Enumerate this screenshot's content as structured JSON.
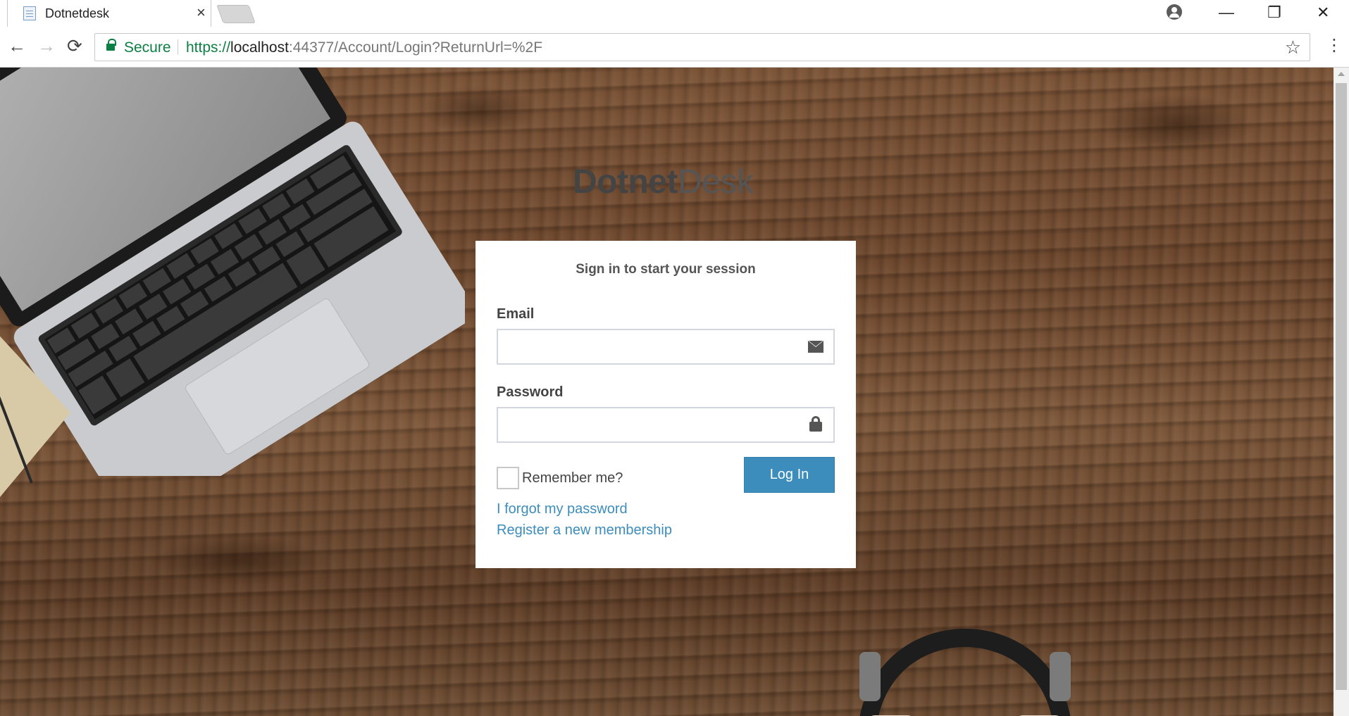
{
  "browser": {
    "tab_title": "Dotnetdesk",
    "tab_close": "×",
    "secure_label": "Secure",
    "url_scheme": "https://",
    "url_host": "localhost",
    "url_rest": ":44377/Account/Login?ReturnUrl=%2F",
    "icons": {
      "back": "←",
      "forward": "→",
      "reload": "⟳",
      "star": "☆",
      "menu": "⋮",
      "minimize": "—",
      "restore": "❐",
      "close": "✕"
    }
  },
  "login": {
    "brand_bold": "Dotnet",
    "brand_light": "Desk",
    "box_message": "Sign in to start your session",
    "email_label": "Email",
    "email_value": "",
    "password_label": "Password",
    "password_value": "",
    "remember_label": "Remember me?",
    "login_button": "Log In",
    "forgot_link": "I forgot my password",
    "register_link": "Register a new membership"
  },
  "colors": {
    "primary_button": "#3c8dbc",
    "link": "#3c8dbc",
    "secure_green": "#0b8043"
  }
}
